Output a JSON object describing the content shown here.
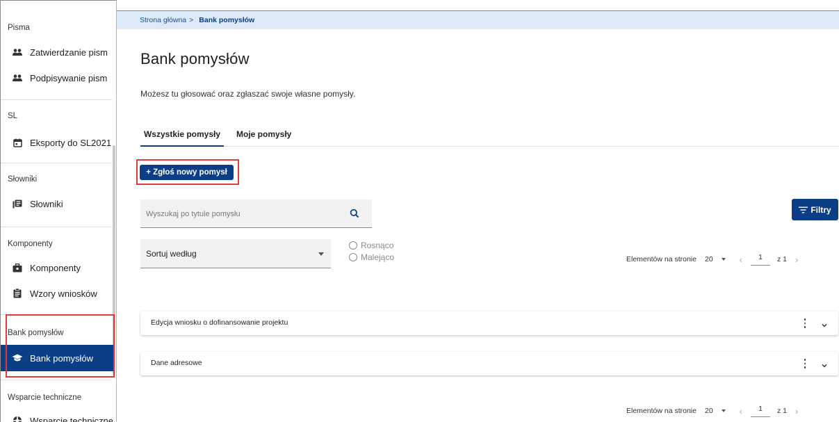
{
  "sidebar": {
    "sections": [
      {
        "title": "Pisma",
        "items": [
          {
            "label": "Zatwierdzanie pism",
            "icon": "people-icon"
          },
          {
            "label": "Podpisywanie pism",
            "icon": "people-icon"
          }
        ]
      },
      {
        "title": "SL",
        "items": [
          {
            "label": "Eksporty do SL2021",
            "icon": "calendar-icon"
          }
        ]
      },
      {
        "title": "Słowniki",
        "items": [
          {
            "label": "Słowniki",
            "icon": "dictionary-icon"
          }
        ]
      },
      {
        "title": "Komponenty",
        "items": [
          {
            "label": "Komponenty",
            "icon": "components-icon"
          },
          {
            "label": "Wzory wniosków",
            "icon": "document-icon"
          }
        ]
      },
      {
        "title": "Bank pomysłów",
        "items": [
          {
            "label": "Bank pomysłów",
            "icon": "graduation-cap-icon",
            "active": true
          }
        ]
      },
      {
        "title": "Wsparcie techniczne",
        "items": [
          {
            "label": "Wsparcie techniczne",
            "icon": "support-icon"
          }
        ]
      }
    ]
  },
  "breadcrumb": {
    "home": "Strona główna",
    "separator": ">",
    "current": "Bank pomysłów"
  },
  "page": {
    "title": "Bank pomysłów",
    "description": "Możesz tu głosować oraz zgłaszać swoje własne pomysły."
  },
  "tabs": [
    {
      "label": "Wszystkie pomysły",
      "active": true
    },
    {
      "label": "Moje pomysły",
      "active": false
    }
  ],
  "actions": {
    "add_idea": "+ Zgłoś nowy pomysł",
    "filters": "Filtry"
  },
  "search": {
    "placeholder": "Wyszukaj po tytule pomysłu",
    "value": ""
  },
  "sort": {
    "label": "Sortuj według",
    "options": [
      "Rosnąco",
      "Malejąco"
    ]
  },
  "pagination": {
    "per_page_label": "Elementów na stronie",
    "per_page": "20",
    "page": "1",
    "of_label": "z 1"
  },
  "ideas": [
    {
      "title": "Edycja wniosku o dofinansowanie projektu"
    },
    {
      "title": "Dane adresowe"
    }
  ],
  "colors": {
    "primary": "#0c3e88",
    "breadcrumb_bg": "#dce9f6",
    "highlight_border": "#e03a3a",
    "sidebar_accent": "#f0a55a"
  }
}
